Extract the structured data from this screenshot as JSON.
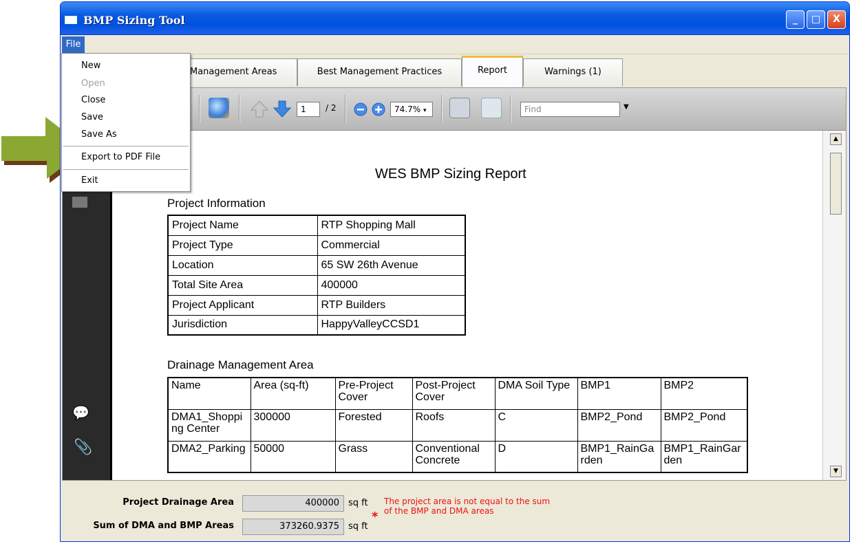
{
  "window": {
    "title": "BMP Sizing Tool",
    "minimize": "_",
    "maximize": "□",
    "close": "X"
  },
  "menubar": {
    "file": "File"
  },
  "file_menu": {
    "items": [
      {
        "label": "New",
        "enabled": true
      },
      {
        "label": "Open",
        "enabled": false
      },
      {
        "label": "Close",
        "enabled": true
      },
      {
        "label": "Save",
        "enabled": true
      },
      {
        "label": "Save As",
        "enabled": true
      },
      {
        "label": "Export to PDF File",
        "enabled": true
      },
      {
        "label": "Exit",
        "enabled": true
      }
    ]
  },
  "tabs": [
    {
      "label": "Management Areas",
      "active": false
    },
    {
      "label": "Best Management Practices",
      "active": false
    },
    {
      "label": "Report",
      "active": true
    },
    {
      "label": "Warnings (1)",
      "active": false
    }
  ],
  "toolbar": {
    "page_current": "1",
    "page_total": "/ 2",
    "zoom": "74.7%",
    "find_placeholder": "Find"
  },
  "report": {
    "title": "WES BMP Sizing Report",
    "project_info_heading": "Project Information",
    "project_info": [
      [
        "Project Name",
        "RTP Shopping Mall"
      ],
      [
        "Project Type",
        "Commercial"
      ],
      [
        "Location",
        "65 SW 26th Avenue"
      ],
      [
        "Total Site Area",
        "400000"
      ],
      [
        "Project Applicant",
        "RTP Builders"
      ],
      [
        "Jurisdiction",
        "HappyValleyCCSD1"
      ]
    ],
    "dma_heading": "Drainage Management Area",
    "dma_headers": [
      "Name",
      "Area (sq-ft)",
      "Pre-Project Cover",
      "Post-Project Cover",
      "DMA Soil Type",
      "BMP1",
      "BMP2"
    ],
    "dma_rows": [
      [
        "DMA1_Shopping Center",
        "300000",
        "Forested",
        "Roofs",
        "C",
        "BMP2_Pond",
        "BMP2_Pond"
      ],
      [
        "DMA2_Parking",
        "50000",
        "Grass",
        "Conventional Concrete",
        "D",
        "BMP1_RainGarden",
        "BMP1_RainGarden"
      ]
    ]
  },
  "bottom": {
    "drainage_label": "Project Drainage Area",
    "drainage_value": "400000",
    "sum_label": "Sum of DMA and BMP Areas",
    "sum_value": "373260.9375",
    "unit": "sq ft",
    "warning": "The project area is not equal to the sum of the BMP and DMA areas",
    "warning_star": "*"
  },
  "colors": {
    "titlebar": "#0a5ae0",
    "menu_highlight": "#316ac5",
    "active_tab_accent": "#f5b73c",
    "arrow": "#8aa832",
    "warning": "#e11111"
  }
}
